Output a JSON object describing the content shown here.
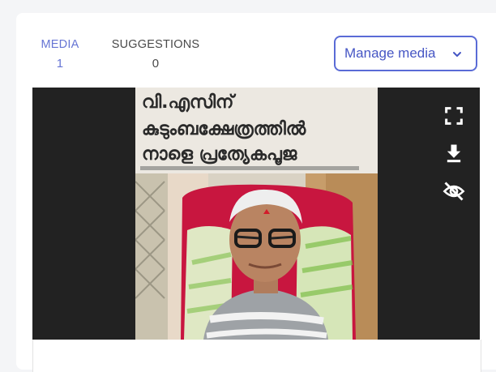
{
  "tabs": {
    "media": {
      "label": "MEDIA",
      "count": "1"
    },
    "suggestions": {
      "label": "SUGGESTIONS",
      "count": "0"
    }
  },
  "manage_button": {
    "label": "Manage media",
    "icon": "chevron-down-icon"
  },
  "media_viewer": {
    "controls": [
      "fullscreen-icon",
      "download-icon",
      "eye-off-icon"
    ],
    "photo_text": [
      "വി.എസിന്",
      "കുടുംബക്ഷേത്രത്തിൽ",
      "നാളെ പ്രത്യേകപൂജ"
    ]
  },
  "colors": {
    "accent": "#5a6bd6",
    "panel_bg": "#222222",
    "card_bg": "#ffffff",
    "page_bg": "#f4f5f7"
  }
}
